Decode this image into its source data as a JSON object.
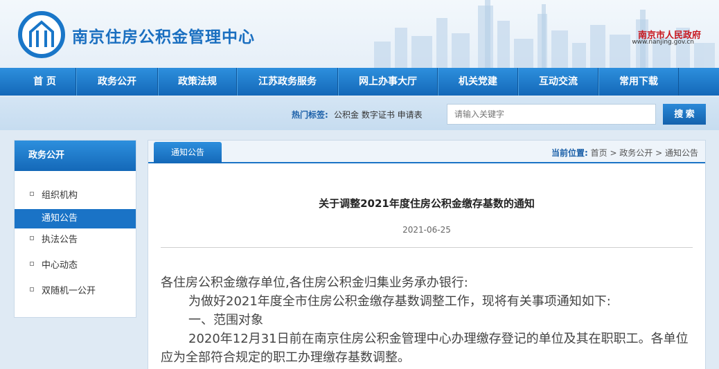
{
  "header": {
    "site_title": "南京住房公积金管理中心",
    "gov_name": "南京市人民政府",
    "gov_url": "www.nanjing.gov.cn"
  },
  "nav": {
    "items": [
      {
        "label": "首 页"
      },
      {
        "label": "政务公开"
      },
      {
        "label": "政策法规"
      },
      {
        "label": "江苏政务服务"
      },
      {
        "label": "网上办事大厅"
      },
      {
        "label": "机关党建"
      },
      {
        "label": "互动交流"
      },
      {
        "label": "常用下载"
      }
    ]
  },
  "search": {
    "hot_label": "热门标签:",
    "hot_tags": "公积金 数字证书 申请表",
    "placeholder": "请输入关键字",
    "button_label": "搜 索"
  },
  "sidebar": {
    "title": "政务公开",
    "items": [
      {
        "label": "组织机构"
      },
      {
        "label": "通知公告"
      },
      {
        "label": "执法公告"
      },
      {
        "label": "中心动态"
      },
      {
        "label": "双随机一公开"
      }
    ]
  },
  "content": {
    "tab_label": "通知公告",
    "breadcrumb": {
      "prefix": "当前位置:",
      "path": "首页 > 政务公开 > 通知公告"
    },
    "article": {
      "title": "关于调整2021年度住房公积金缴存基数的通知",
      "date": "2021-06-25",
      "paragraphs": [
        "各住房公积金缴存单位,各住房公积金归集业务承办银行:",
        "为做好2021年度全市住房公积金缴存基数调整工作，现将有关事项通知如下:",
        "一、范围对象",
        "2020年12月31日前在南京住房公积金管理中心办理缴存登记的单位及其在职职工。各单位应为全部符合规定的职工办理缴存基数调整。"
      ]
    }
  }
}
